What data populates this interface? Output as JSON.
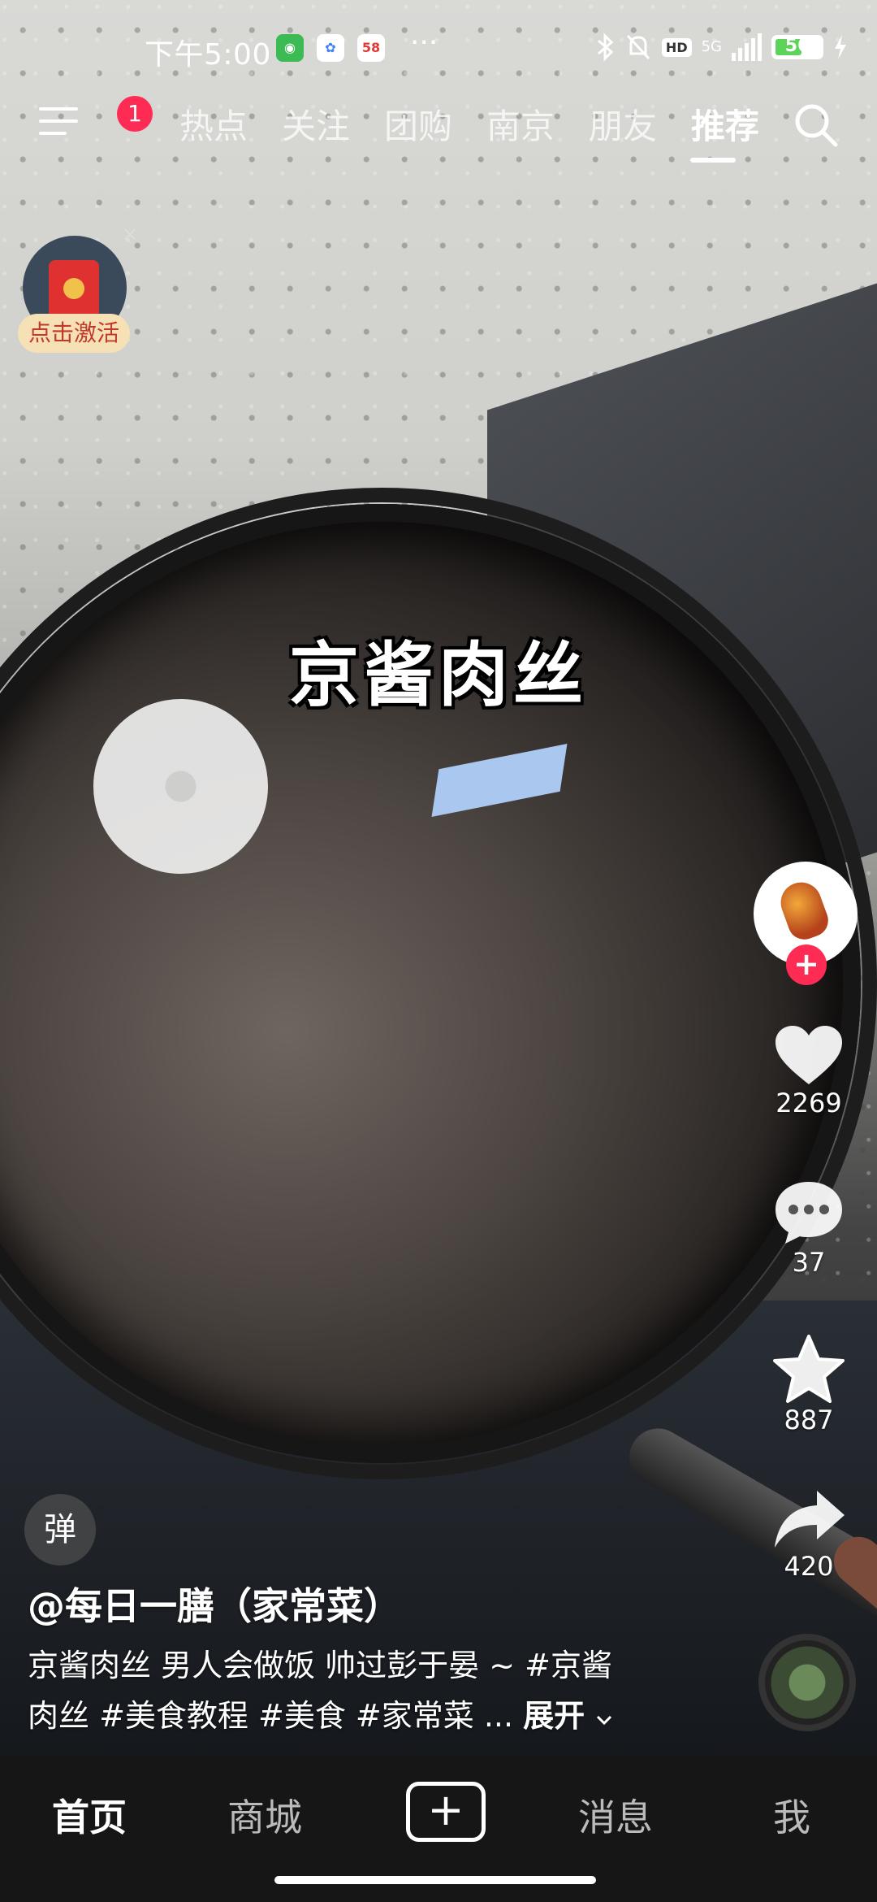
{
  "status_bar": {
    "time": "下午5:00",
    "more": "···",
    "network": "5G",
    "hd": "HD",
    "battery": "56"
  },
  "top_nav": {
    "badge_count": "1",
    "tabs": [
      "热点",
      "关注",
      "团购",
      "南京",
      "朋友",
      "推荐"
    ],
    "active_tab": "推荐"
  },
  "red_packet": {
    "label": "点击激活",
    "close": "×"
  },
  "video": {
    "overlay_title": "京酱肉丝"
  },
  "actions": {
    "like_count": "2269",
    "comment_count": "37",
    "favorite_count": "887",
    "share_count": "420",
    "follow_symbol": "+"
  },
  "danmaku": {
    "label": "弹"
  },
  "caption": {
    "author": "@每日一膳（家常菜）",
    "line1": "京酱肉丝 男人会做饭 帅过彭于晏 ~ #京酱",
    "line2": "肉丝 #美食教程 #美食 #家常菜 ...",
    "expand": "展开"
  },
  "bottom_nav": {
    "items": [
      "首页",
      "商城",
      "消息",
      "我"
    ],
    "plus": "+"
  },
  "colors": {
    "accent": "#fe2c55",
    "battery": "#5ed35c"
  }
}
